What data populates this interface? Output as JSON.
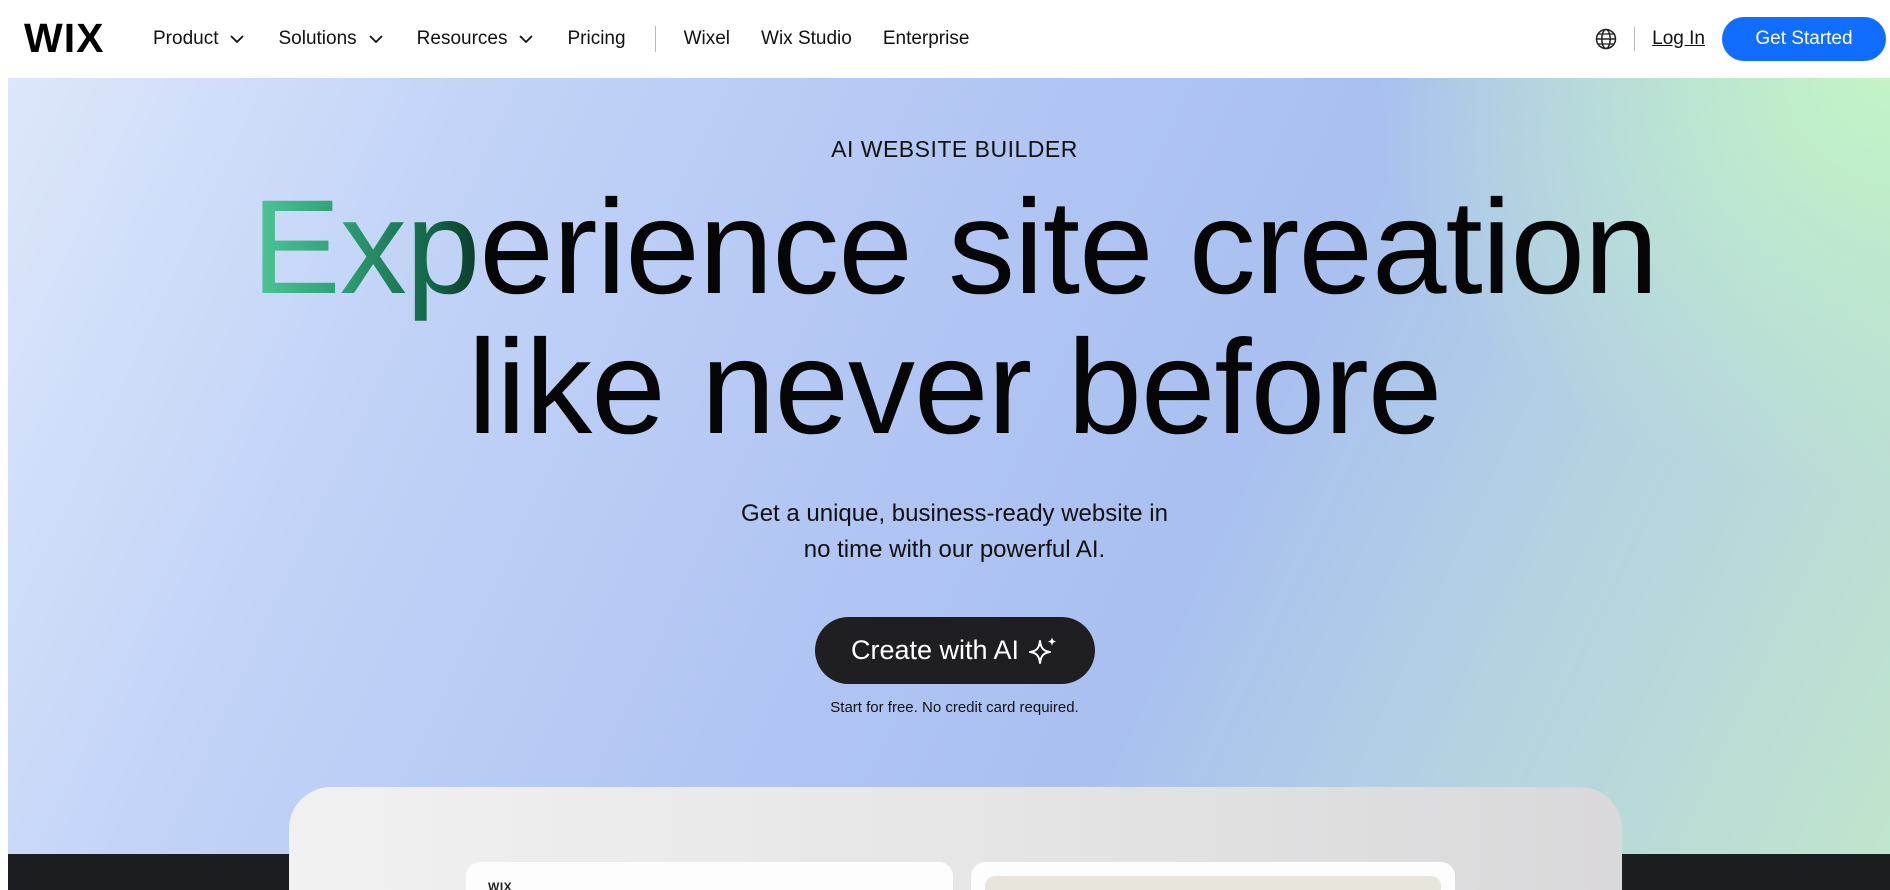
{
  "brand": {
    "logo": "WIX"
  },
  "nav": {
    "items": [
      {
        "label": "Product",
        "dropdown": true
      },
      {
        "label": "Solutions",
        "dropdown": true
      },
      {
        "label": "Resources",
        "dropdown": true
      },
      {
        "label": "Pricing",
        "dropdown": false
      }
    ],
    "secondary": [
      {
        "label": "Wixel"
      },
      {
        "label": "Wix Studio"
      },
      {
        "label": "Enterprise"
      }
    ]
  },
  "header_right": {
    "language_icon": "globe-icon",
    "login_label": "Log In",
    "get_started_label": "Get Started"
  },
  "hero": {
    "eyebrow": "AI WEBSITE BUILDER",
    "headline_accent": "Exp",
    "headline_rest_line1": "erience site creation",
    "headline_line2": "like never before",
    "subtitle_line1": "Get a unique, business-ready website in",
    "subtitle_line2": "no time with our powerful AI.",
    "cta_label": "Create with AI",
    "cta_icon": "sparkle-icon",
    "note": "Start for free. No credit card required."
  },
  "preview": {
    "mini_logo": "WIX"
  },
  "colors": {
    "primary_button": "#116dff",
    "cta_button": "#1f1f22",
    "accent_gradient_start": "#4fc79a",
    "accent_gradient_end": "#0c3b2a"
  }
}
